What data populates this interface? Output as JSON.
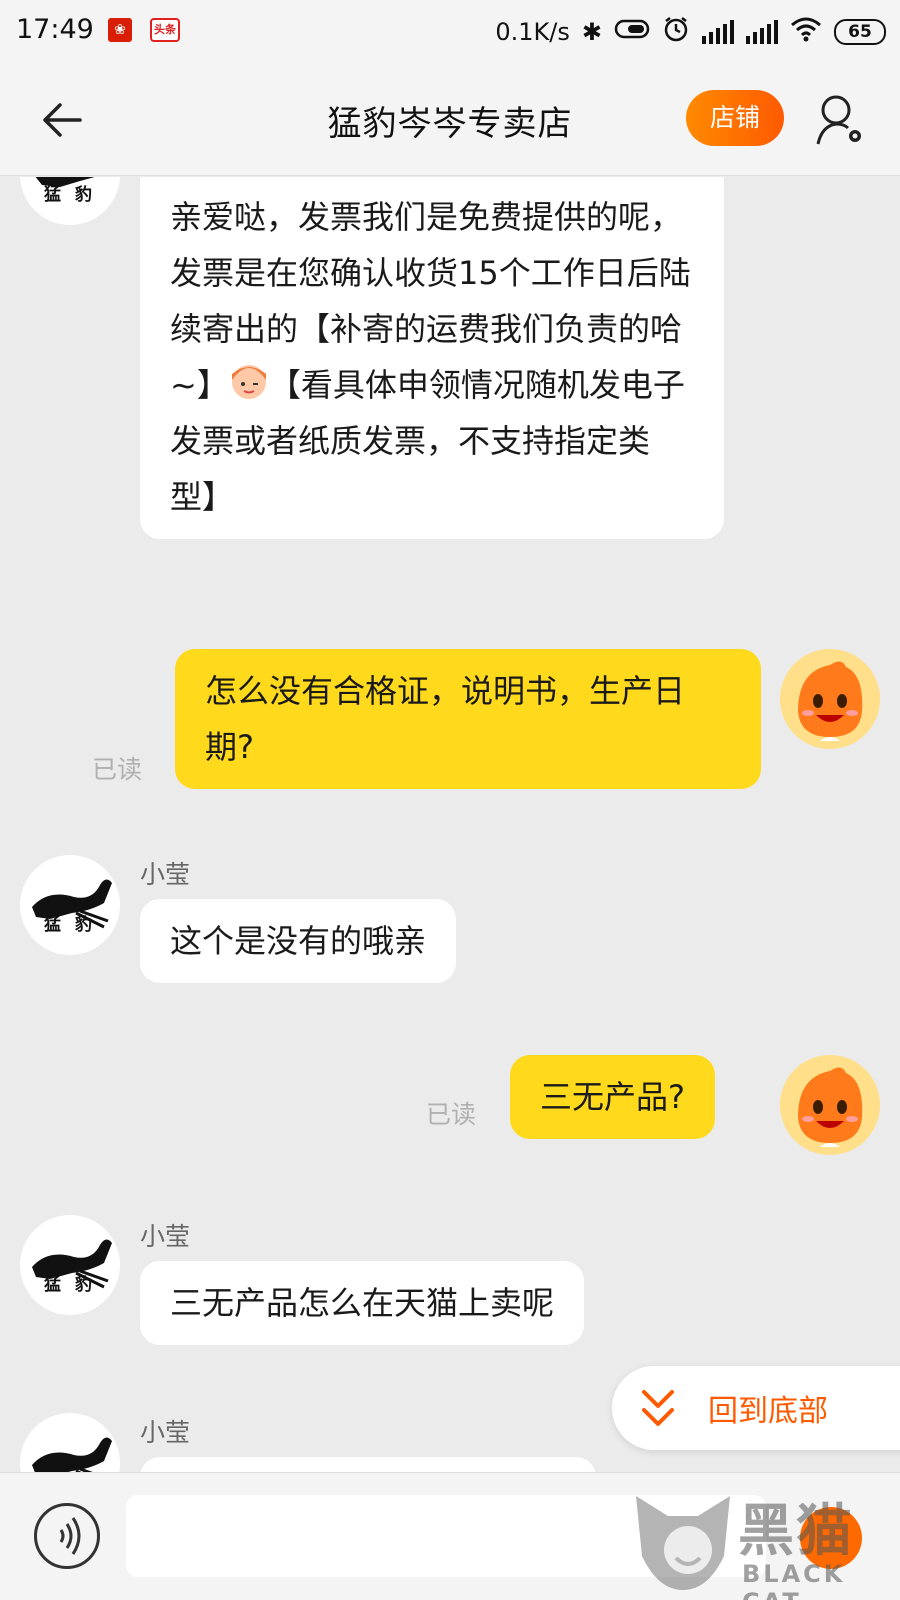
{
  "status_bar": {
    "time": "17:49",
    "network_speed": "0.1K/s",
    "battery": "65"
  },
  "header": {
    "title": "猛豹岑岑专卖店",
    "shop_button": "店铺"
  },
  "shop_avatar_text": "猛豹",
  "messages": [
    {
      "text": "亲爱哒，发票我们是免费提供的呢，发票是在您确认收货15个工作日后陆续寄出的【补寄的运费我们负责的哈~】",
      "text2": "【看具体申领情况随机发电子发票或者纸质发票，不支持指定类型】"
    },
    {
      "text": "怎么没有合格证，说明书，生产日期?",
      "status": "已读"
    },
    {
      "sender": "小莹",
      "text": "这个是没有的哦亲"
    },
    {
      "text": "三无产品?",
      "status": "已读"
    },
    {
      "sender": "小莹",
      "text": "三无产品怎么在天猫上卖呢"
    },
    {
      "sender": "小莹"
    }
  ],
  "back_to_bottom": "回到底部",
  "input": {
    "value": "",
    "placeholder": ""
  },
  "watermark": {
    "cn": "黑猫",
    "en": "BLACK CAT"
  },
  "colors": {
    "outgoing_bubble": "#ffd91c",
    "incoming_bubble": "#ffffff",
    "accent": "#ff5a00",
    "background": "#ebebeb"
  }
}
